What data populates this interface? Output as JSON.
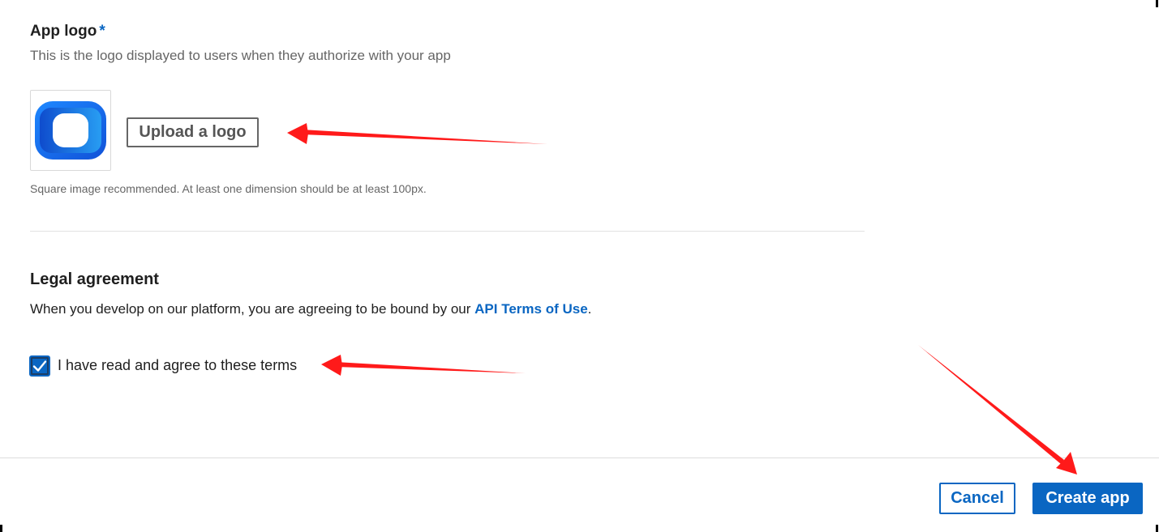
{
  "app_logo": {
    "title": "App logo",
    "required_marker": "*",
    "helper": "This is the logo displayed to users when they authorize with your app",
    "upload_label": "Upload a logo",
    "recommendation": "Square image recommended. At least one dimension should be at least 100px.",
    "logo_icon": "app-logo-icon",
    "logo_colors": [
      "#1565e8",
      "#29b6f6"
    ]
  },
  "legal": {
    "title": "Legal agreement",
    "text_before": "When you develop on our platform, you are agreeing to be bound by our ",
    "link_text": "API Terms of Use",
    "text_after": ".",
    "checkbox_label": "I have read and agree to these terms",
    "checkbox_checked": true
  },
  "footer": {
    "cancel_label": "Cancel",
    "create_label": "Create app"
  },
  "colors": {
    "accent": "#0a66c2",
    "annotation_arrow": "#ff0000"
  }
}
